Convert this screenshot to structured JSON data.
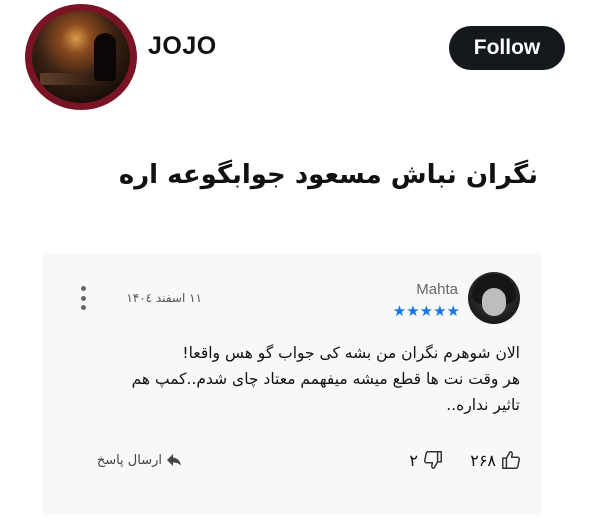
{
  "profile": {
    "username": "JOJO",
    "follow_label": "Follow"
  },
  "post": {
    "headline": "نگران نباش مسعود جوابگوعه اره"
  },
  "review": {
    "author": "Mahta",
    "rating": 5,
    "stars": "★★★★★",
    "date": "۱۱ اسفند ۱۴۰٤",
    "text_lines": [
      "الان شوهرم نگران من بشه کی جواب گو هس واقعا!",
      "هر وقت نت ها قطع میشه میفهمم معتاد چای شدم..کمپ هم",
      "تاثیر نداره.."
    ],
    "likes": "۲۶۸",
    "dislikes": "۲",
    "reply_label": "ارسال پاسخ"
  },
  "colors": {
    "follow_bg": "#15181d",
    "avatar_ring": "#7a1424",
    "star": "#1677e6",
    "card_bg": "#f7f8fa"
  },
  "icons": [
    "thumbs-up-icon",
    "thumbs-down-icon",
    "reply-arrow-icon",
    "more-vertical-icon",
    "star-icon"
  ]
}
